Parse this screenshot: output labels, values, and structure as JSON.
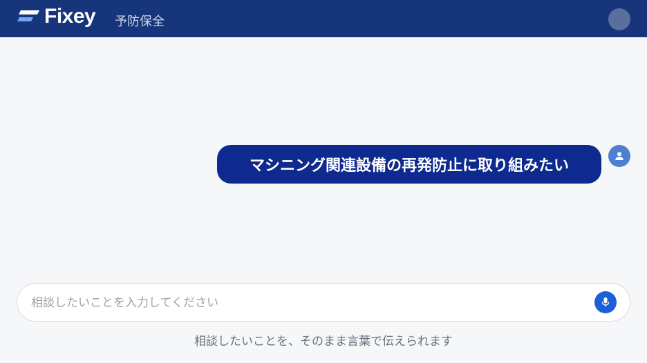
{
  "header": {
    "brand": "Fixey",
    "section": "予防保全",
    "logo_icon": "fixey-logo-icon",
    "avatar_icon": "user-avatar-icon",
    "background_color": "#16357a"
  },
  "conversation": {
    "messages": [
      {
        "role": "user",
        "text": "マシニング関連設備の再発防止に取り組みたい",
        "avatar_icon": "user-icon"
      }
    ],
    "bubble_color": "#0e2a8f"
  },
  "composer": {
    "placeholder": "相談したいことを入力してください",
    "value": "",
    "mic_icon": "microphone-icon",
    "mic_color": "#1d5fd6",
    "hint": "相談したいことを、そのまま言葉で伝えられます"
  }
}
